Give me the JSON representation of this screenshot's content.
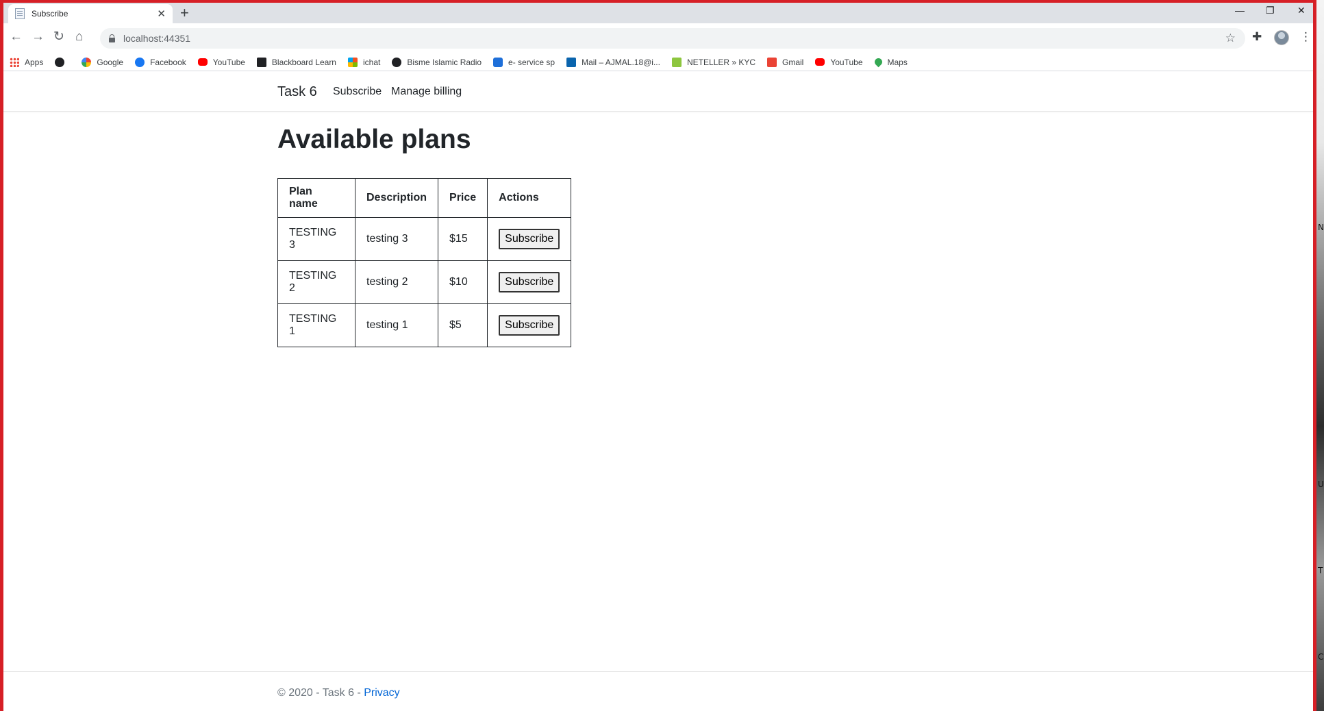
{
  "browser": {
    "tab_title": "Subscribe",
    "url": "localhost:44351",
    "bookmarks": [
      {
        "label": "Apps",
        "icon": "apps-icon"
      },
      {
        "label": "",
        "icon": "globe-icon"
      },
      {
        "label": "Google",
        "icon": "google-icon"
      },
      {
        "label": "Facebook",
        "icon": "facebook-icon"
      },
      {
        "label": "YouTube",
        "icon": "youtube-icon"
      },
      {
        "label": "Blackboard Learn",
        "icon": "blackboard-icon"
      },
      {
        "label": "ichat",
        "icon": "microsoft-icon"
      },
      {
        "label": "Bisme Islamic Radio",
        "icon": "globe-icon"
      },
      {
        "label": "e- service sp",
        "icon": "sharepoint-icon"
      },
      {
        "label": "Mail – AJMAL.18@i...",
        "icon": "outlook-icon"
      },
      {
        "label": "NETELLER » KYC",
        "icon": "neteller-icon"
      },
      {
        "label": "Gmail",
        "icon": "gmail-icon"
      },
      {
        "label": "YouTube",
        "icon": "youtube-icon"
      },
      {
        "label": "Maps",
        "icon": "maps-icon"
      }
    ]
  },
  "site": {
    "brand": "Task 6",
    "nav": {
      "subscribe": "Subscribe",
      "billing": "Manage billing"
    }
  },
  "main": {
    "heading": "Available plans",
    "table": {
      "headers": [
        "Plan name",
        "Description",
        "Price",
        "Actions"
      ],
      "rows": [
        {
          "name": "TESTING 3",
          "description": "testing 3",
          "price": "$15",
          "action": "Subscribe"
        },
        {
          "name": "TESTING 2",
          "description": "testing 2",
          "price": "$10",
          "action": "Subscribe"
        },
        {
          "name": "TESTING 1",
          "description": "testing 1",
          "price": "$5",
          "action": "Subscribe"
        }
      ]
    }
  },
  "footer": {
    "text": "© 2020 - Task 6 - ",
    "link": "Privacy"
  },
  "desktop": {
    "glyphs": [
      "N",
      "U",
      "T",
      "C"
    ]
  },
  "colors": {
    "window_border": "#d61f26",
    "link": "#0366d6"
  }
}
